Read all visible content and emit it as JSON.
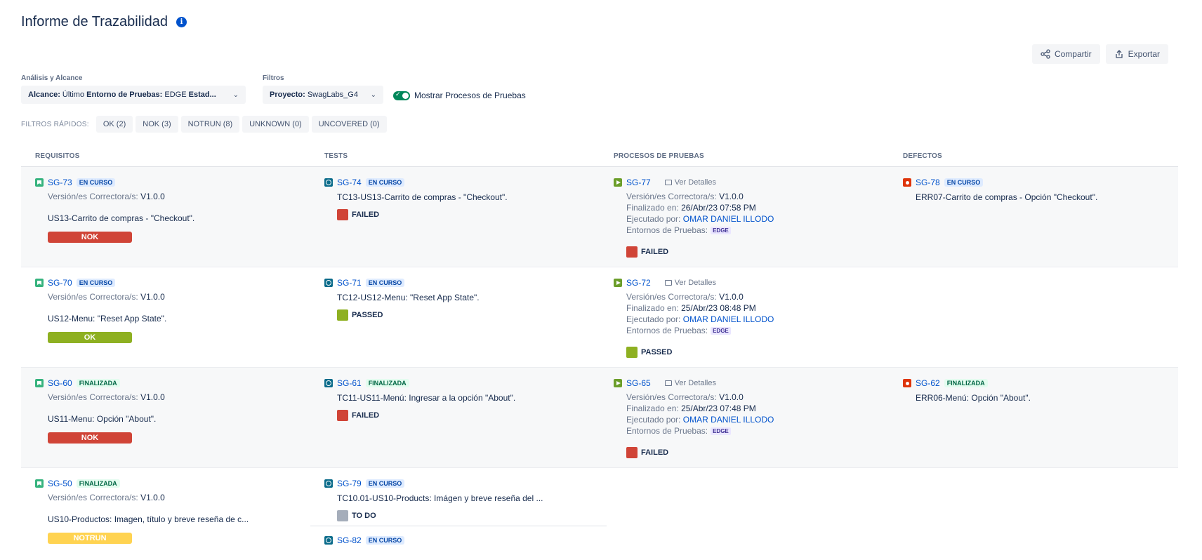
{
  "header": {
    "title": "Informe de Trazabilidad",
    "info_glyph": "i"
  },
  "actions": {
    "share": "Compartir",
    "export": "Exportar"
  },
  "filters": {
    "analysis_label": "Análisis y Alcance",
    "scope_key": "Alcance:",
    "scope_value": "Último",
    "env_key": "Entorno de Pruebas:",
    "env_value": "EDGE",
    "state_key": "Estad...",
    "filters_label": "Filtros",
    "project_key": "Proyecto:",
    "project_value": "SwagLabs_G4",
    "toggle_label": "Mostrar Procesos de Pruebas"
  },
  "quick_filters": {
    "label": "FILTROS RÁPIDOS:",
    "items": [
      "OK (2)",
      "NOK (3)",
      "NOTRUN (8)",
      "UNKNOWN (0)",
      "UNCOVERED (0)"
    ]
  },
  "columns": [
    "REQUISITOS",
    "TESTS",
    "PROCESOS DE PRUEBAS",
    "DEFECTOS"
  ],
  "labels": {
    "version": "Versión/es Correctora/s:",
    "finished": "Finalizado en:",
    "executed": "Ejecutado por:",
    "environments": "Entornos de Pruebas:",
    "details": "Ver Detalles",
    "edge": "EDGE"
  },
  "rows": [
    {
      "req": {
        "key": "SG-73",
        "status": "EN CURSO",
        "version": "V1.0.0",
        "summary": "US13-Carrito de compras - \"Checkout\".",
        "result": "NOK"
      },
      "test": {
        "key": "SG-74",
        "status": "EN CURSO",
        "summary": "TC13-US13-Carrito de compras - \"Checkout\".",
        "result": "FAILED"
      },
      "exec": {
        "key": "SG-77",
        "version": "V1.0.0",
        "finished": "26/Abr/23 07:58 PM",
        "executor": "OMAR DANIEL ILLODO",
        "result": "FAILED"
      },
      "defect": {
        "key": "SG-78",
        "status": "EN CURSO",
        "summary": "ERR07-Carrito de compras - Opción \"Checkout\"."
      }
    },
    {
      "req": {
        "key": "SG-70",
        "status": "EN CURSO",
        "version": "V1.0.0",
        "summary": "US12-Menu: \"Reset App State\".",
        "result": "OK"
      },
      "test": {
        "key": "SG-71",
        "status": "EN CURSO",
        "summary": "TC12-US12-Menu: \"Reset App State\".",
        "result": "PASSED"
      },
      "exec": {
        "key": "SG-72",
        "version": "V1.0.0",
        "finished": "25/Abr/23 08:48 PM",
        "executor": "OMAR DANIEL ILLODO",
        "result": "PASSED"
      }
    },
    {
      "req": {
        "key": "SG-60",
        "status": "FINALIZADA",
        "version": "V1.0.0",
        "summary": "US11-Menu: Opción \"About\".",
        "result": "NOK"
      },
      "test": {
        "key": "SG-61",
        "status": "FINALIZADA",
        "summary": "TC11-US11-Menú: Ingresar a la opción \"About\".",
        "result": "FAILED"
      },
      "exec": {
        "key": "SG-65",
        "version": "V1.0.0",
        "finished": "25/Abr/23 07:48 PM",
        "executor": "OMAR DANIEL ILLODO",
        "result": "FAILED"
      },
      "defect": {
        "key": "SG-62",
        "status": "FINALIZADA",
        "summary": "ERR06-Menú: Opción \"About\"."
      }
    },
    {
      "req": {
        "key": "SG-50",
        "status": "FINALIZADA",
        "version": "V1.0.0",
        "summary": "US10-Productos: Imagen, título y breve reseña de c...",
        "result": "NOTRUN"
      },
      "test": {
        "key": "SG-79",
        "status": "EN CURSO",
        "summary": "TC10.01-US10-Products: Imágen y breve reseña del ...",
        "result": "TO DO"
      },
      "test2": {
        "key": "SG-82",
        "status": "EN CURSO"
      }
    }
  ]
}
